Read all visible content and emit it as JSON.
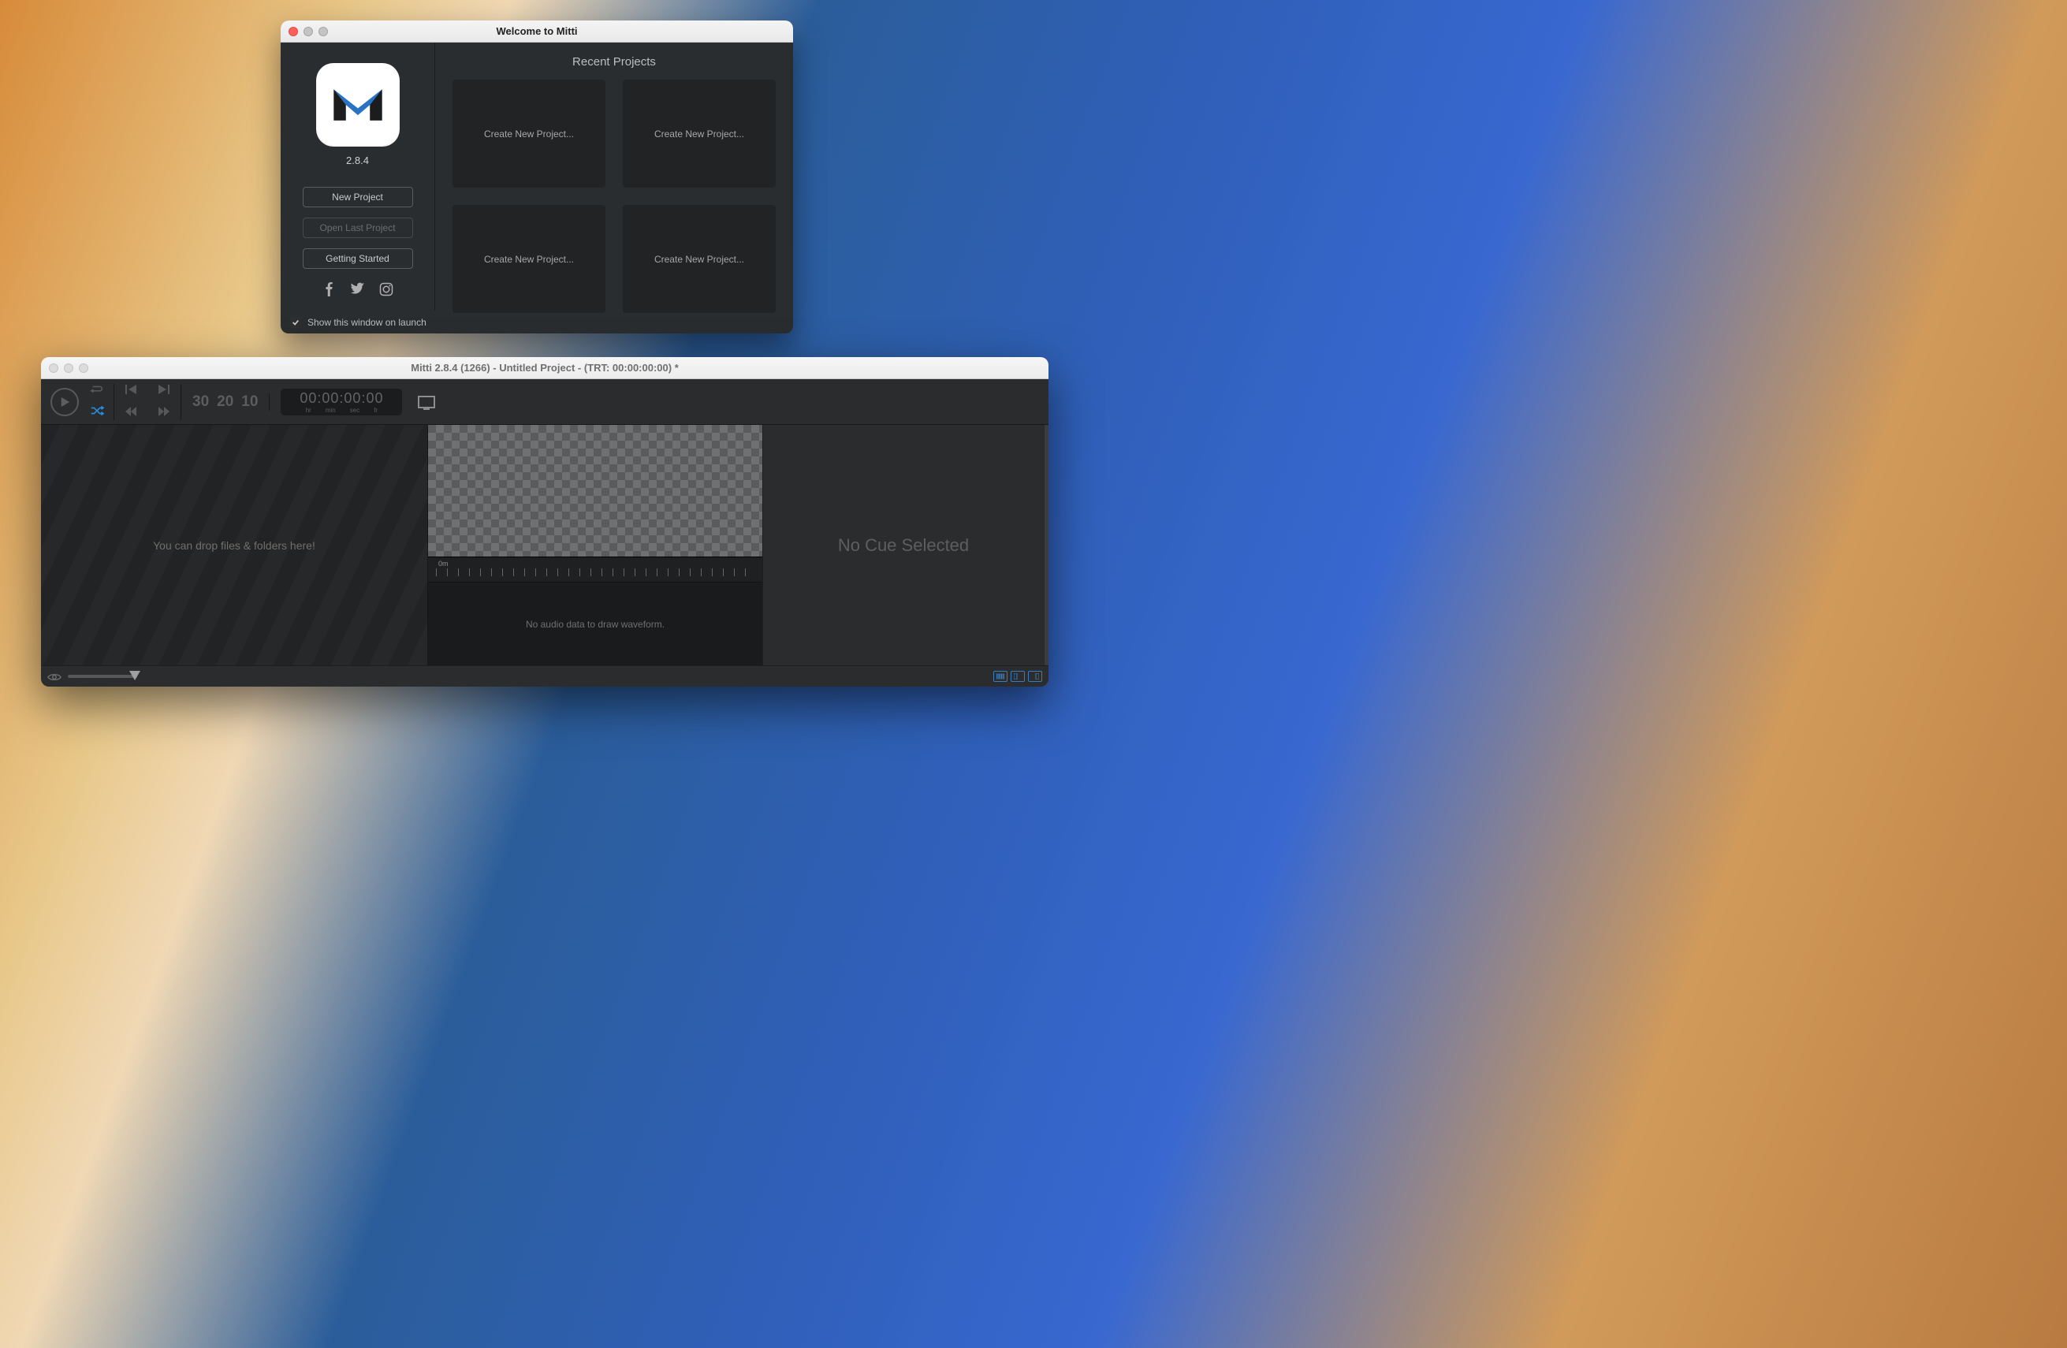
{
  "welcome": {
    "title": "Welcome to Mitti",
    "version": "2.8.4",
    "buttons": {
      "new_project": "New Project",
      "open_last": "Open Last Project",
      "getting_started": "Getting Started"
    },
    "recent_title": "Recent Projects",
    "recent_placeholder": "Create New Project...",
    "show_on_launch": "Show this window on launch",
    "show_on_launch_checked": true
  },
  "main": {
    "title": "Mitti 2.8.4 (1266) - Untitled Project - (TRT: 00:00:00:00) *",
    "timecode": "00:00:00:00",
    "tc_units": {
      "hr": "hr",
      "min": "min",
      "sec": "sec",
      "fr": "fr"
    },
    "fps_options": [
      "30",
      "20",
      "10"
    ],
    "drop_hint": "You can drop files & folders here!",
    "no_audio": "No audio data to draw waveform.",
    "no_cue": "No Cue Selected",
    "timeline_zero": "0m"
  }
}
